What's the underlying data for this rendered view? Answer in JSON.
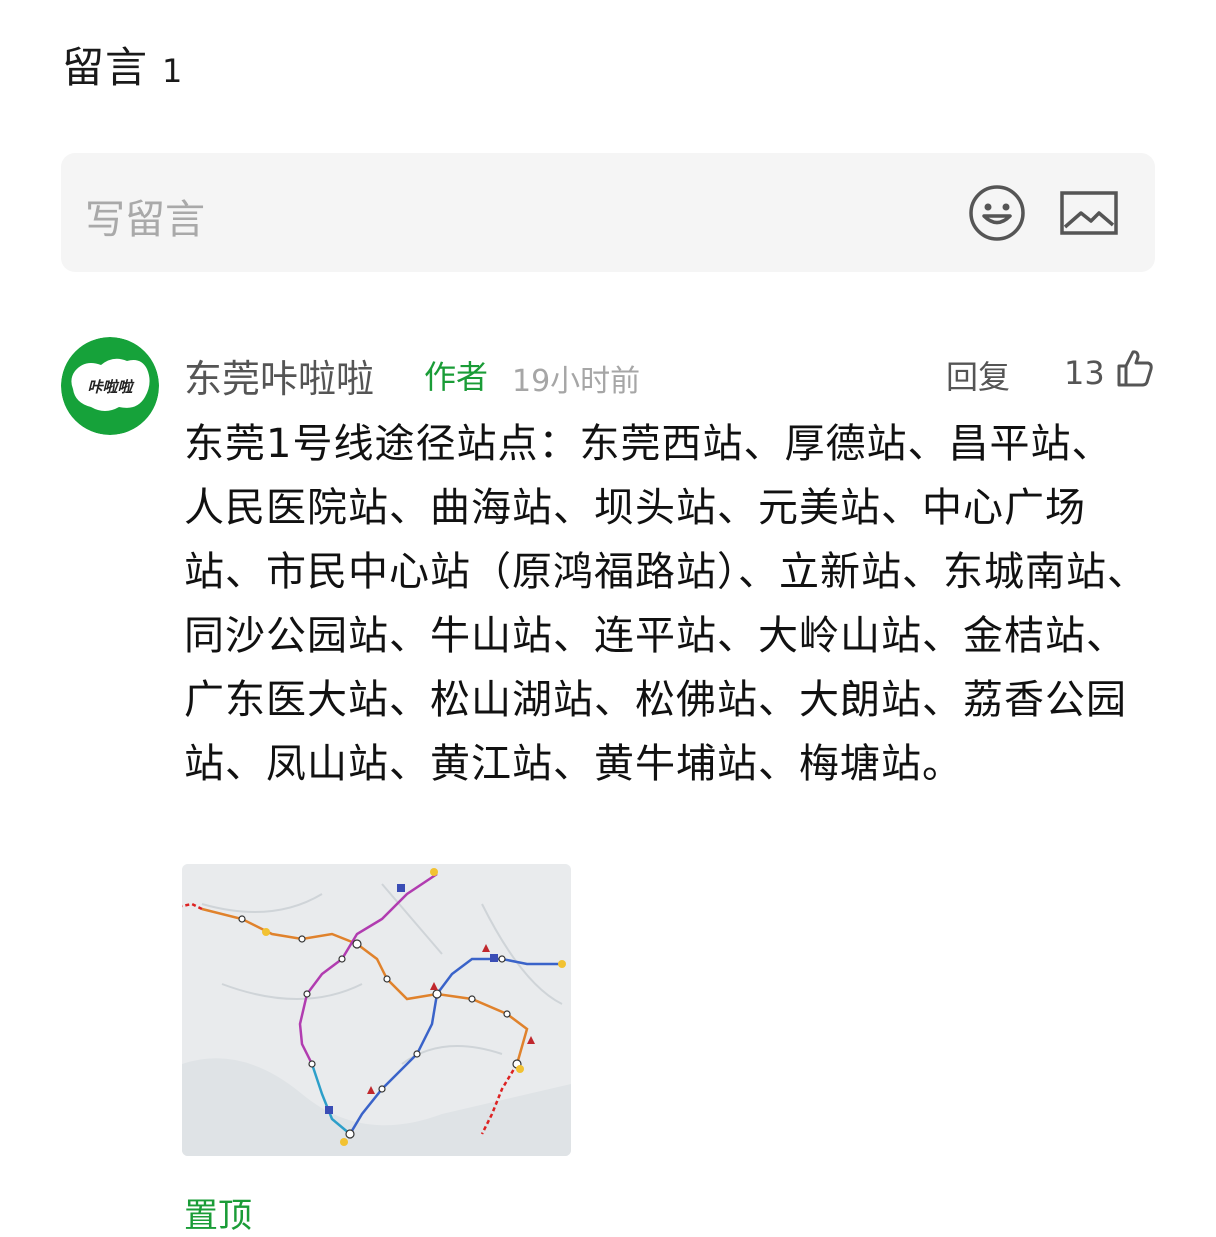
{
  "header": {
    "title": "留言",
    "count": "1"
  },
  "write_box": {
    "placeholder": "写留言",
    "emoji_icon": "smiley-face-icon",
    "image_icon": "picture-icon"
  },
  "comment": {
    "avatar_text": "咔啦啦",
    "author": "东莞咔啦啦",
    "author_tag": "作者",
    "time": "19小时前",
    "reply_label": "回复",
    "like_count": "13",
    "like_icon": "thumbs-up-icon",
    "text": "东莞1号线途径站点：东莞西站、厚德站、昌平站、人民医院站、曲海站、坝头站、元美站、中心广场站、市民中心站（原鸿福路站）、立新站、东城南站、同沙公园站、牛山站、连平站、大岭山站、金桔站、广东医大站、松山湖站、松佛站、大朗站、荔香公园站、凤山站、黄江站、黄牛埔站、梅塘站。",
    "image": "metro-line-map-photo",
    "pinned_label": "置顶"
  },
  "colors": {
    "accent_green": "#1a9c37",
    "input_bg": "#f5f5f5",
    "placeholder_gray": "#a9a9a9"
  }
}
